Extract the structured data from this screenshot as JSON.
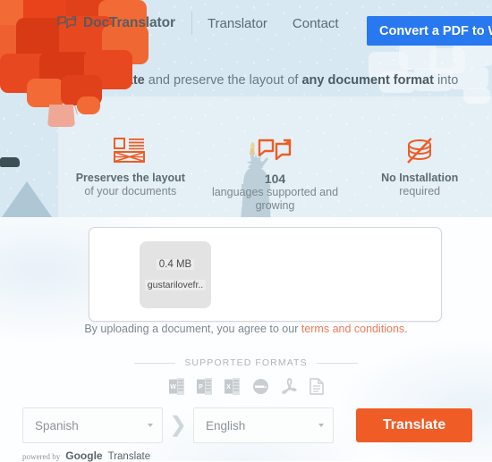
{
  "navbar": {
    "brand_icon": "speech-bubbles-icon",
    "brand": "DocTranslator",
    "links": [
      {
        "label": "Translator"
      },
      {
        "label": "Contact"
      }
    ],
    "cta": {
      "label": "Convert a PDF to Word",
      "color": "#2878f0"
    }
  },
  "hero": {
    "tagline": {
      "part1": "Instantly translate",
      "part2": " and preserve the layout of ",
      "part3": "any document format",
      "part4": " into"
    },
    "features": [
      {
        "icon": "document-layout-icon",
        "title": "Preserves the layout",
        "subtitle": "of your documents"
      },
      {
        "icon": "language-bubbles-icon",
        "count": "104",
        "subtitle": "languages supported and growing"
      },
      {
        "icon": "no-install-disc-icon",
        "title": "No Installation",
        "subtitle": "required"
      }
    ],
    "watermark": "statue-of-liberty-icon",
    "balloon": "hot-air-balloon-speech-bubbles"
  },
  "upload": {
    "file": {
      "size": "0.4 MB",
      "name": "gustarilovefr.."
    },
    "terms_prefix": "By uploading a document, you agree to our ",
    "terms_link": "terms and conditions",
    "terms_suffix": "."
  },
  "formats": {
    "label": "SUPPORTED FORMATS",
    "icons": [
      {
        "name": "word-doc-icon",
        "letter": "W",
        "color": "#c9ced1"
      },
      {
        "name": "powerpoint-icon",
        "letter": "P",
        "color": "#c9ced1"
      },
      {
        "name": "excel-icon",
        "letter": "X",
        "color": "#c9ced1"
      },
      {
        "name": "openoffice-icon",
        "letter": "",
        "color": "#c9ced1"
      },
      {
        "name": "pdf-acrobat-icon",
        "letter": "",
        "color": "#c9ced1"
      },
      {
        "name": "text-file-icon",
        "letter": "",
        "color": "#c9ced1"
      }
    ]
  },
  "translate_bar": {
    "source_language": "Spanish",
    "target_language": "English",
    "swap_icon": "chevron-right-icon",
    "button_label": "Translate",
    "button_color": "#ef5c26"
  },
  "powered_by": {
    "prefix": "powered by",
    "google": "Google",
    "translate": "Translate"
  },
  "theme": {
    "sky": "#d7e8f2",
    "orange": "#ef5c26",
    "blue": "#2878f0"
  }
}
